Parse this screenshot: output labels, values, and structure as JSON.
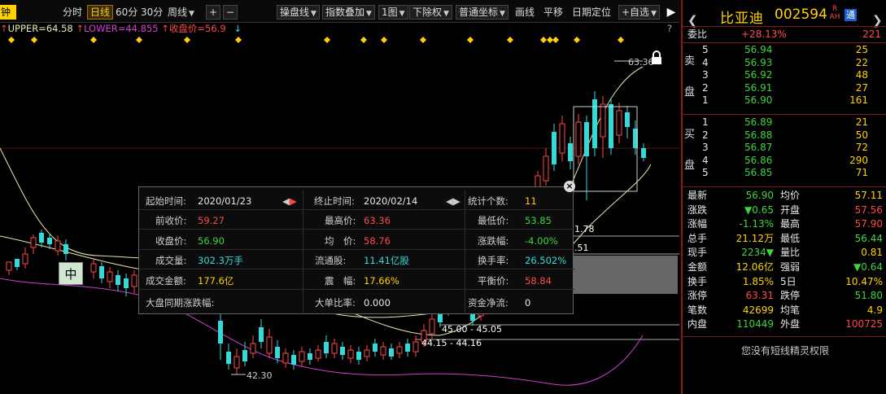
{
  "toolbar": {
    "period_min": "钟",
    "period_fen": "分时",
    "period_day": "日线",
    "period_60": "60分",
    "period_30": "30分",
    "period_week": "周线",
    "plus": "+",
    "minus": "−",
    "menu_caopan": "操盘线",
    "menu_zhishu": "指数叠加",
    "menu_tu": "1图",
    "menu_chuquan": "下除权",
    "menu_zuobiao": "普通坐标",
    "btn_huaxian": "画线",
    "btn_pingyi": "平移",
    "btn_riqi": "日期定位",
    "btn_zixuan": "+自选",
    "collapse": "▶"
  },
  "indicator": {
    "upper": "UPPER=64.58",
    "lower": "LOWER=44.855",
    "close": "收盘价=56.9",
    "help": "?"
  },
  "chart_labels": {
    "high_price": "63.36",
    "low_price": "42.30",
    "p1": "1.78",
    "p2": ".51",
    "range1": "45.00 - 45.05",
    "range2": "44.15 - 44.16"
  },
  "mid_badge": "中",
  "info_panel": {
    "start_time_label": "起始时间:",
    "start_time": "2020/01/23",
    "end_time_label": "终止时间:",
    "end_time": "2020/02/14",
    "count_label": "统计个数:",
    "count": "11",
    "prev_close_label": "前收价:",
    "prev_close": "59.27",
    "high_label": "最高价:",
    "high": "63.36",
    "low_label": "最低价:",
    "low": "53.85",
    "close_label": "收盘价:",
    "close": "56.90",
    "avg_label": "均　价:",
    "avg": "58.76",
    "change_label": "涨跌幅:",
    "change": "-4.00%",
    "volume_label": "成交量:",
    "volume": "302.3万手",
    "float_label": "流通股:",
    "float_shares": "11.41亿股",
    "turnover_label": "换手率:",
    "turnover": "26.502%",
    "amount_label": "成交金额:",
    "amount": "177.6亿",
    "amplitude_label": "震　幅:",
    "amplitude": "17.66%",
    "balance_label": "平衡价:",
    "balance": "58.84",
    "market_label": "大盘同期涨跌幅:",
    "market": "",
    "bigorder_label": "大单比率:",
    "bigorder": "0.000",
    "netflow_label": "资金净流:",
    "netflow": "0",
    "close_icon": "×"
  },
  "right_panel": {
    "name": "比亚迪",
    "code": "002594",
    "rah_r": "R",
    "rah_ah": "AH",
    "tong": "通",
    "prev": "❮",
    "next": "❯",
    "weibi_label": "委比",
    "weibi_pct": "+28.13%",
    "weibi_val": "221",
    "sell_label_1": "卖",
    "sell_label_2": "盘",
    "buy_label_1": "买",
    "buy_label_2": "盘",
    "sell": [
      {
        "lvl": "5",
        "price": "56.94",
        "vol": "25"
      },
      {
        "lvl": "4",
        "price": "56.93",
        "vol": "22"
      },
      {
        "lvl": "3",
        "price": "56.92",
        "vol": "48"
      },
      {
        "lvl": "2",
        "price": "56.91",
        "vol": "27"
      },
      {
        "lvl": "1",
        "price": "56.90",
        "vol": "161"
      }
    ],
    "buy": [
      {
        "lvl": "1",
        "price": "56.89",
        "vol": "21"
      },
      {
        "lvl": "2",
        "price": "56.88",
        "vol": "50"
      },
      {
        "lvl": "3",
        "price": "56.87",
        "vol": "72"
      },
      {
        "lvl": "4",
        "price": "56.86",
        "vol": "290"
      },
      {
        "lvl": "5",
        "price": "56.85",
        "vol": "71"
      }
    ],
    "stats": [
      {
        "l1": "最新",
        "v1": "56.90",
        "l2": "均价",
        "v2": "57.11",
        "c1": "green",
        "c2": "yellow"
      },
      {
        "l1": "涨跌",
        "v1": "▼0.65",
        "l2": "开盘",
        "v2": "57.56",
        "c1": "green",
        "c2": "red"
      },
      {
        "l1": "涨幅",
        "v1": "-1.13%",
        "l2": "最高",
        "v2": "57.90",
        "c1": "green",
        "c2": "red"
      },
      {
        "l1": "总手",
        "v1": "21.12万",
        "l2": "最低",
        "v2": "56.44",
        "c1": "yellow",
        "c2": "green"
      },
      {
        "l1": "现手",
        "v1": "2234▼",
        "l2": "量比",
        "v2": "0.81",
        "c1": "green",
        "c2": "yellow"
      },
      {
        "l1": "金额",
        "v1": "12.06亿",
        "l2": "强弱",
        "v2": "▼0.64",
        "c1": "yellow",
        "c2": "green"
      },
      {
        "l1": "换手",
        "v1": "1.85%",
        "l2": "5日",
        "v2": "10.47%",
        "c1": "yellow",
        "c2": "yellow"
      },
      {
        "l1": "涨停",
        "v1": "63.31",
        "l2": "跌停",
        "v2": "51.80",
        "c1": "red",
        "c2": "green"
      },
      {
        "l1": "笔数",
        "v1": "42699",
        "l2": "均笔",
        "v2": "4.9",
        "c1": "yellow",
        "c2": "yellow"
      },
      {
        "l1": "内盘",
        "v1": "110449",
        "l2": "外盘",
        "v2": "100725",
        "c1": "green",
        "c2": "red"
      }
    ],
    "no_permission": "您没有短线精灵权限"
  },
  "colors": {
    "up": "#ff4848",
    "down": "#38d8d8",
    "upper_band": "#e8e8b0",
    "lower_band": "#d040d0",
    "accent": "#ffd200"
  }
}
